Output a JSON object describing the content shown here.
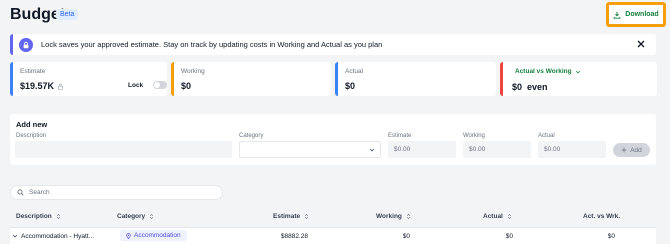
{
  "header": {
    "title": "Budget",
    "beta": "Beta",
    "download_label": "Download"
  },
  "banner": {
    "text": "Lock saves your approved estimate. Stay on track by updating costs in Working and Actual as you plan"
  },
  "cards": {
    "estimate": {
      "label": "Estimate",
      "value": "$19.57K",
      "lock_label": "Lock"
    },
    "working": {
      "label": "Working",
      "value": "$0"
    },
    "actual": {
      "label": "Actual",
      "value": "$0"
    },
    "avw": {
      "label": "Actual vs Working",
      "value": "$0  even"
    }
  },
  "add_new": {
    "title": "Add new",
    "labels": {
      "description": "Description",
      "category": "Category",
      "estimate": "Estimate",
      "working": "Working",
      "actual": "Actual"
    },
    "placeholders": {
      "estimate": "$0.00",
      "working": "$0.00",
      "actual": "$0.00"
    },
    "add_label": "Add"
  },
  "search": {
    "placeholder": "Search"
  },
  "table": {
    "columns": [
      "Description",
      "Category",
      "Estimate",
      "Working",
      "Actual",
      "Act. vs Wrk."
    ],
    "rows": [
      {
        "description": "Accommodation - Hyatt...",
        "category": "Accommodation",
        "estimate": "$8882.28",
        "working": "$0",
        "actual": "$0",
        "act_vs_wrk": "$0"
      }
    ]
  },
  "colors": {
    "accent": "#6366f1",
    "download_highlight": "#f59e0b",
    "green": "#15803d",
    "red": "#ef4444",
    "blue": "#3b82f6"
  },
  "icons": [
    "download-icon",
    "lock-icon",
    "close-icon",
    "chevron-down-icon",
    "plus-icon",
    "search-icon",
    "sort-icon",
    "map-pin-icon"
  ]
}
